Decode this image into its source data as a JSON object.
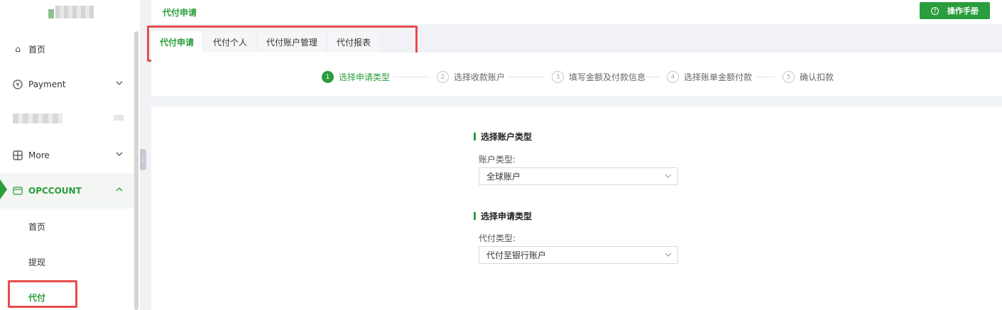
{
  "sidebar": {
    "items": [
      {
        "label": "首页",
        "icon": "home-icon"
      },
      {
        "label": "Payment",
        "icon": "yuan-circle-icon"
      },
      {
        "label": "More",
        "icon": "grid-icon"
      },
      {
        "label": "OPCCOUNT",
        "icon": "card-icon"
      }
    ],
    "sub_items": [
      {
        "label": "首页"
      },
      {
        "label": "提现"
      },
      {
        "label": "代付"
      }
    ]
  },
  "header": {
    "title": "代付申请",
    "manual_button": "操作手册"
  },
  "tabs": [
    {
      "label": "代付申请"
    },
    {
      "label": "代付个人"
    },
    {
      "label": "代付账户管理"
    },
    {
      "label": "代付报表"
    }
  ],
  "steps": [
    {
      "num": "1",
      "label": "选择申请类型"
    },
    {
      "num": "2",
      "label": "选择收款账户"
    },
    {
      "num": "3",
      "label": "填写金额及付款信息"
    },
    {
      "num": "4",
      "label": "选择账单金额付款"
    },
    {
      "num": "5",
      "label": "确认扣款"
    }
  ],
  "form": {
    "section1_title": "选择账户类型",
    "account_type_label": "账户类型:",
    "account_type_value": "全球账户",
    "section2_title": "选择申请类型",
    "payout_type_label": "代付类型:",
    "payout_type_value": "代付至银行账户"
  },
  "colors": {
    "accent": "#2a9d3c",
    "highlight_box": "#e74c4c"
  }
}
